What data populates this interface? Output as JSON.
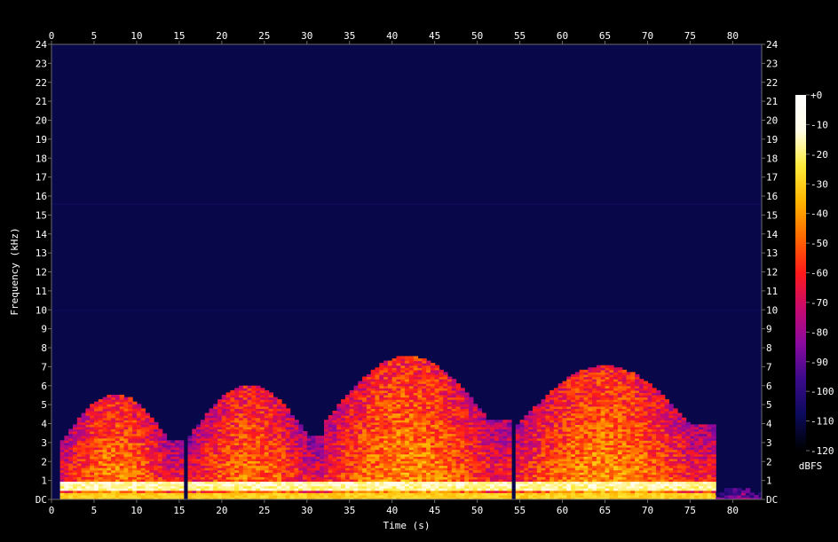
{
  "chart_data": {
    "type": "heatmap",
    "xlabel": "Time (s)",
    "ylabel": "Frequency (kHz)",
    "colorbar_label": "dBFS",
    "xlim": [
      0,
      83.4
    ],
    "ylim": [
      0,
      24
    ],
    "zlim": [
      -120,
      0
    ],
    "x_ticks": [
      0,
      5,
      10,
      15,
      20,
      25,
      30,
      35,
      40,
      45,
      50,
      55,
      60,
      65,
      70,
      75,
      80
    ],
    "y_ticks": [
      "DC",
      "1",
      "2",
      "3",
      "4",
      "5",
      "6",
      "7",
      "8",
      "9",
      "10",
      "11",
      "12",
      "13",
      "14",
      "15",
      "16",
      "17",
      "18",
      "19",
      "20",
      "21",
      "22",
      "23",
      "24"
    ],
    "colorbar_ticks": [
      "+0",
      "-10",
      "-20",
      "-30",
      "-40",
      "-50",
      "-60",
      "-70",
      "-80",
      "-90",
      "-100",
      "-110",
      "-120"
    ],
    "colors": {
      "background": "#000000",
      "plot_bg": "#07074a",
      "frame": "#6b6b6b",
      "text": "#ffffff",
      "colormap": [
        "#000000",
        "#0a0a5a",
        "#3a0a8a",
        "#8a0aa0",
        "#c80a6e",
        "#ff1a1a",
        "#ff6a00",
        "#ffb400",
        "#ffeb3b",
        "#fffde8",
        "#ffffff"
      ]
    },
    "activity_segments": [
      {
        "start": 1,
        "end": 15.5,
        "peak_khz": 5.5,
        "level_db": -40
      },
      {
        "start": 16,
        "end": 32,
        "peak_khz": 6,
        "level_db": -42
      },
      {
        "start": 32,
        "end": 54,
        "peak_khz": 7.5,
        "level_db": -38
      },
      {
        "start": 54.5,
        "end": 78,
        "peak_khz": 7,
        "level_db": -38
      },
      {
        "start": 78,
        "end": 83.4,
        "peak_khz": 0.6,
        "level_db": -75
      }
    ],
    "bands": [
      {
        "khz": 0.5,
        "level_db": -18
      },
      {
        "khz": 0.75,
        "level_db": -15
      },
      {
        "khz": 15.6,
        "level_db": -105
      },
      {
        "khz": 10,
        "level_db": -108
      }
    ]
  }
}
